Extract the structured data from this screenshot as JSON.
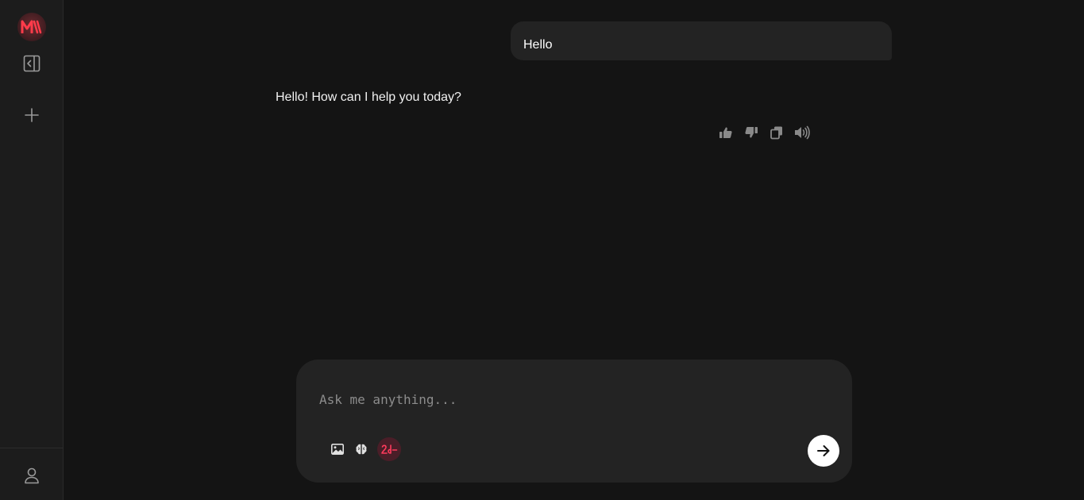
{
  "app": {
    "logo": {
      "icon": "m-logo-icon",
      "text": "M",
      "color": "#ff3b4a"
    }
  },
  "sidebar": {
    "collapse_icon": "sidebar-collapse-icon",
    "new_chat_icon": "plus-icon",
    "profile_icon": "user-icon"
  },
  "chat": {
    "messages": [
      {
        "role": "user",
        "text": "Hello"
      },
      {
        "role": "assistant",
        "text": "Hello! How can I help you today?"
      }
    ],
    "message_actions": [
      "thumbs-up-icon",
      "thumbs-down-icon",
      "copy-icon",
      "speaker-icon"
    ]
  },
  "composer": {
    "placeholder": "Ask me anything...",
    "value": "",
    "tools": [
      "image-icon",
      "brain-icon",
      "mode-toggle-icon"
    ],
    "send_icon": "arrow-right-icon"
  },
  "colors": {
    "background": "#141414",
    "sidebar": "#1c1c1c",
    "bubble": "#232323",
    "accent": "#ff3b4a"
  }
}
